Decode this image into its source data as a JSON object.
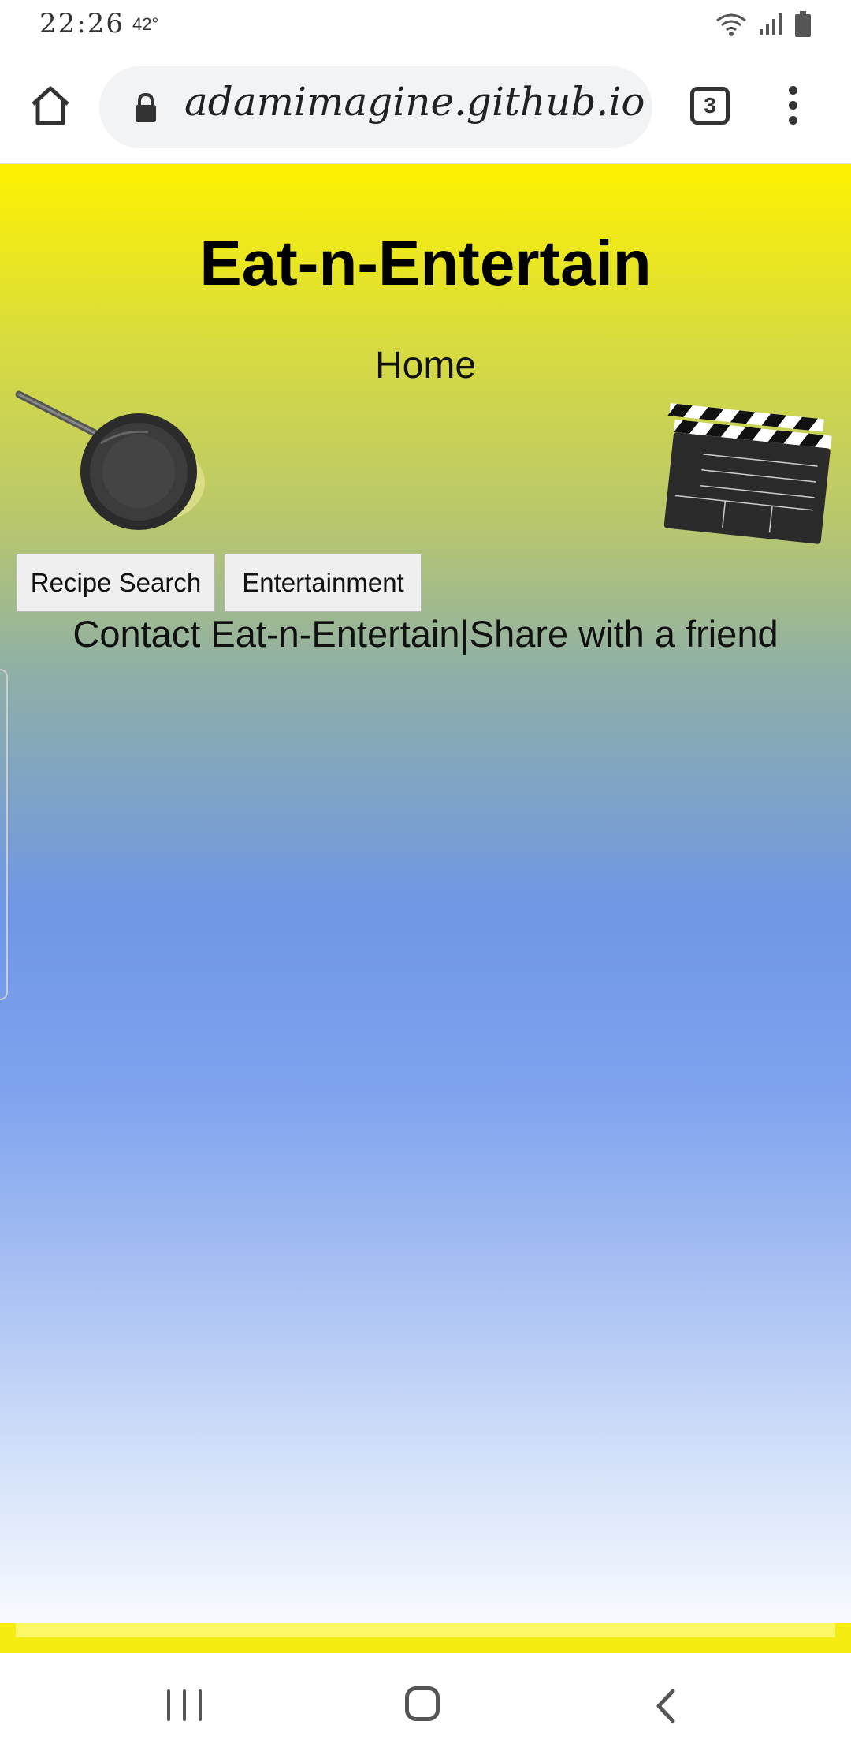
{
  "status_bar": {
    "time": "22:26",
    "temperature": "42°",
    "icons": [
      "wifi-icon",
      "signal-icon",
      "battery-icon"
    ]
  },
  "browser": {
    "url": "adamimagine.github.io",
    "tab_count": "3",
    "icons": [
      "home-icon",
      "lock-icon",
      "tabs-icon",
      "more-vert-icon"
    ]
  },
  "page": {
    "title": "Eat-n-Entertain",
    "nav_home": "Home",
    "buttons": {
      "recipe_search": "Recipe Search",
      "entertainment": "Entertainment"
    },
    "footer": "Contact Eat-n-Entertain|Share with a friend",
    "images": [
      "frying-pan-image",
      "clapperboard-image"
    ],
    "colors": {
      "gradient_top": "#fff200",
      "gradient_middle": "#6f97e6",
      "gradient_bottom": "#ffffff"
    }
  },
  "system_nav": {
    "icons": [
      "recents-icon",
      "home-icon",
      "back-icon"
    ]
  }
}
